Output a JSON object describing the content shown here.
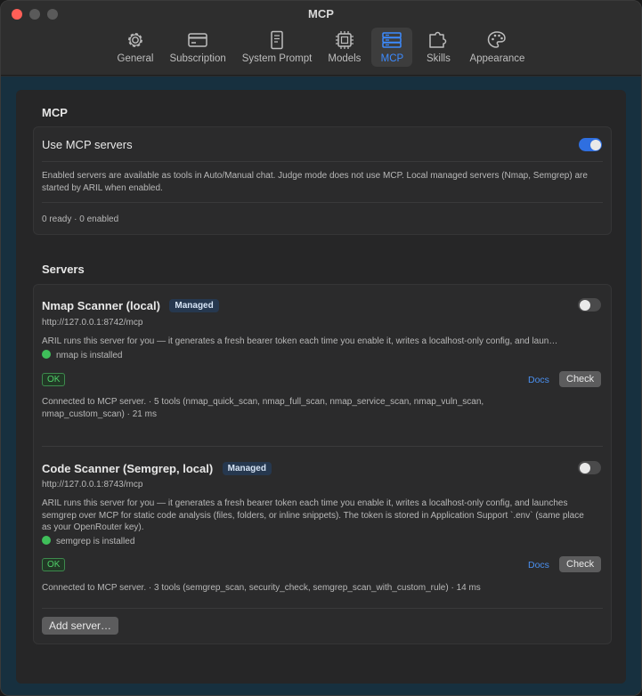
{
  "window": {
    "title": "MCP"
  },
  "toolbar": {
    "items": [
      {
        "label": "General",
        "icon": "gear-icon"
      },
      {
        "label": "Subscription",
        "icon": "credit-card-icon"
      },
      {
        "label": "System Prompt",
        "icon": "document-icon"
      },
      {
        "label": "Models",
        "icon": "chip-icon"
      },
      {
        "label": "MCP",
        "icon": "server-icon",
        "active": true
      },
      {
        "label": "Skills",
        "icon": "puzzle-icon"
      },
      {
        "label": "Appearance",
        "icon": "palette-icon"
      }
    ],
    "active_color": "#3d8bff"
  },
  "mcp_section": {
    "title": "MCP",
    "use_label": "Use MCP servers",
    "use_enabled": true,
    "description": "Enabled servers are available as tools in Auto/Manual chat. Judge mode does not use MCP. Local managed servers (Nmap, Semgrep) are started by ARIL when enabled.",
    "status": "0 ready · 0 enabled"
  },
  "servers_section": {
    "title": "Servers",
    "servers": [
      {
        "name": "Nmap Scanner (local)",
        "badge": "Managed",
        "url": "http://127.0.0.1:8742/mcp",
        "enabled": false,
        "description": "ARIL runs this server for you — it generates a fresh bearer token each time you enable it, writes a localhost-only config, and laun…",
        "installed": "nmap is installed",
        "ok": "OK",
        "docs": "Docs",
        "check": "Check",
        "result": "Connected to MCP server. · 5 tools (nmap_quick_scan, nmap_full_scan, nmap_service_scan, nmap_vuln_scan, nmap_custom_scan) · 21 ms"
      },
      {
        "name": "Code Scanner (Semgrep, local)",
        "badge": "Managed",
        "url": "http://127.0.0.1:8743/mcp",
        "enabled": false,
        "description": "ARIL runs this server for you — it generates a fresh bearer token each time you enable it, writes a localhost-only config, and launches semgrep over MCP for static code analysis (files, folders, or inline snippets). The token is stored in Application Support `.env` (same place as your OpenRouter key).",
        "installed": "semgrep is installed",
        "ok": "OK",
        "docs": "Docs",
        "check": "Check",
        "result": "Connected to MCP server. · 3 tools (semgrep_scan, security_check, semgrep_scan_with_custom_rule) · 14 ms"
      }
    ],
    "add_button": "Add server…"
  },
  "colors": {
    "toggle_on": "#2f6fe0",
    "ok_green": "#4fd069",
    "link_blue": "#4a90f0",
    "badge_bg": "#26384f"
  }
}
